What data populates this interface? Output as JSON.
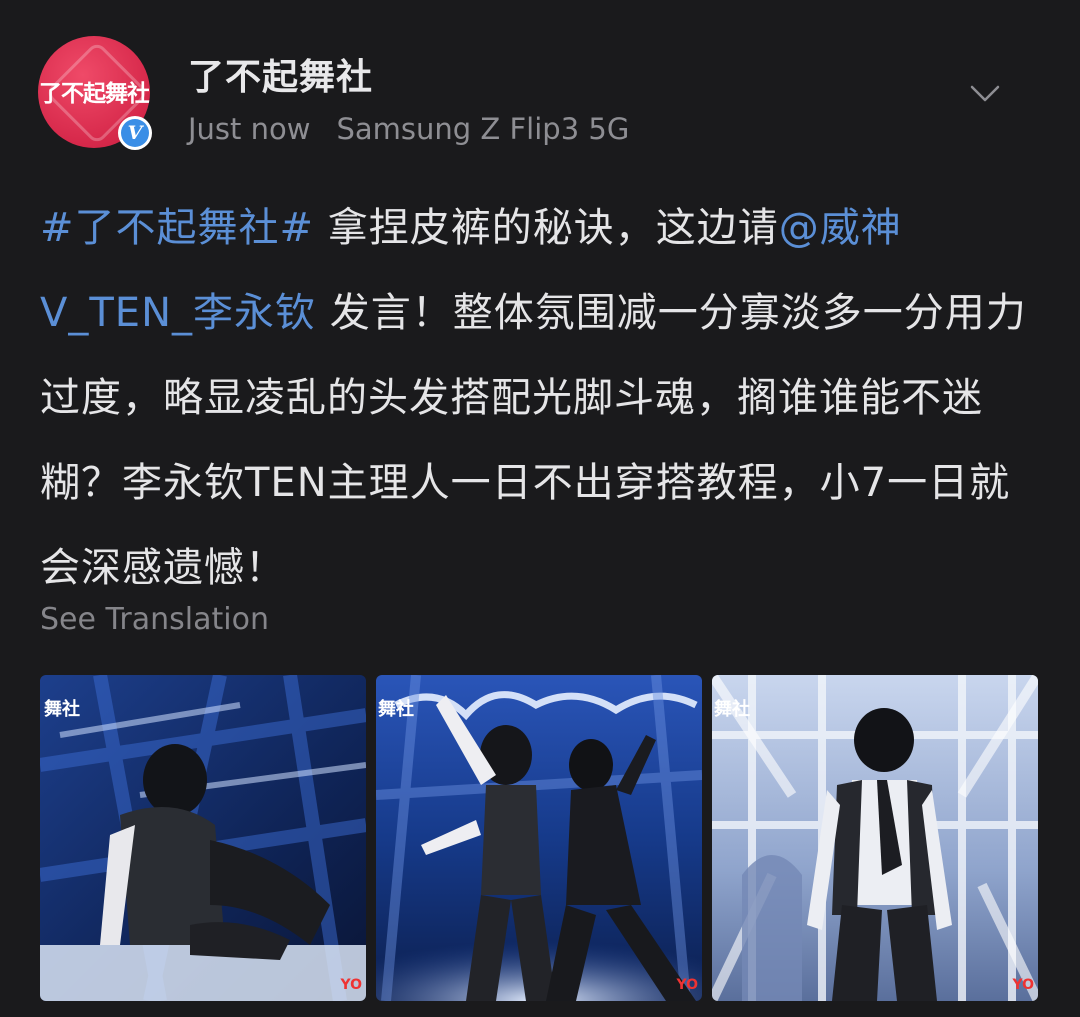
{
  "account": {
    "name": "了不起舞社",
    "avatar_text": "了不起舞社",
    "verified_mark": "V",
    "time": "Just now",
    "device": "Samsung Z Flip3 5G"
  },
  "post": {
    "hashtag": "#了不起舞社#",
    "text_part1": " 拿捏皮裤的秘诀，这边请",
    "mention": "@威神V_TEN_李永钦",
    "text_part2": " 发言！整体氛围减一分寡淡多一分用力过度，略显凌乱的头发搭配光脚斗魂，搁谁谁能不迷糊？李永钦TEN主理人一日不出穿搭教程，小7一日就会深感遗憾！",
    "translate_label": "See Translation"
  },
  "images": [
    {
      "watermark": "舞社",
      "corner": "YO"
    },
    {
      "watermark": "舞社",
      "corner": "YO"
    },
    {
      "watermark": "舞社",
      "corner": "YO"
    }
  ],
  "colors": {
    "background": "#1a1a1c",
    "link": "#5b8fd6",
    "avatar": "#d6284a",
    "verified": "#3a8ee6"
  }
}
